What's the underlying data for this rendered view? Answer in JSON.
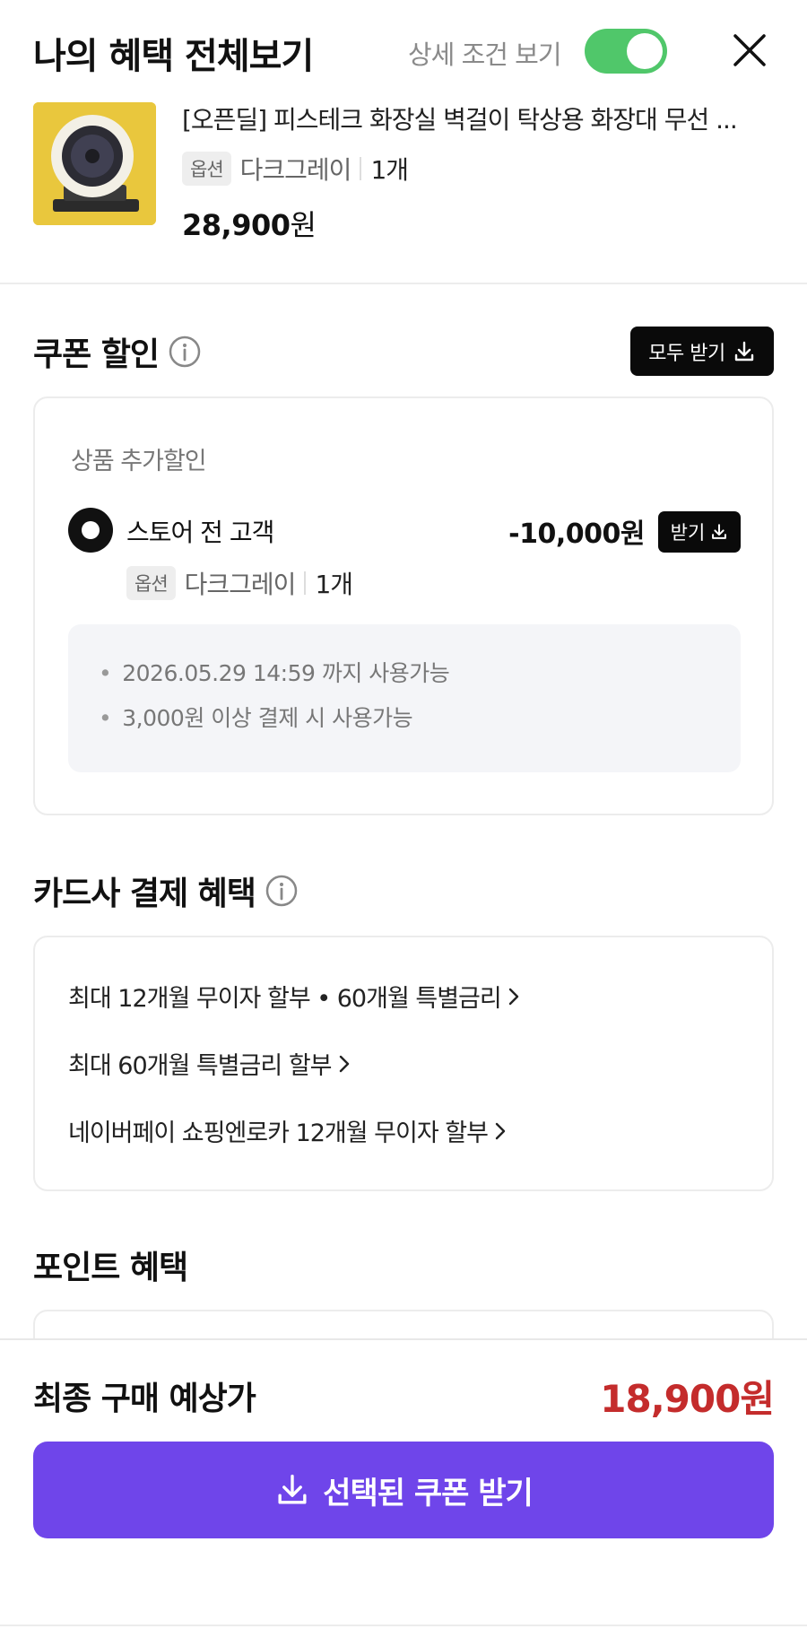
{
  "header": {
    "title": "나의 혜택 전체보기",
    "detail_toggle_label": "상세 조건 보기"
  },
  "product": {
    "title": "[오픈딜] 피스테크 화장실 벽걸이 탁상용 화장대 무선 ...",
    "option_badge": "옵션",
    "option_value": "다크그레이",
    "quantity": "1개",
    "price": "28,900",
    "price_unit": "원"
  },
  "coupon_section": {
    "title": "쿠폰 할인",
    "get_all_label": "모두 받기",
    "category": "상품 추가할인",
    "coupon": {
      "name": "스토어 전 고객",
      "amount": "-10,000",
      "amount_unit": "원",
      "get_label": "받기",
      "option_badge": "옵션",
      "option_value": "다크그레이",
      "quantity": "1개",
      "conditions": [
        "2026.05.29 14:59 까지 사용가능",
        "3,000원 이상 결제 시 사용가능"
      ]
    }
  },
  "card_section": {
    "title": "카드사 결제 혜택",
    "items": [
      "최대 12개월 무이자 할부 • 60개월 특별금리",
      "최대 60개월 특별금리 할부",
      "네이버페이 쇼핑엔로카 12개월 무이자 할부"
    ]
  },
  "points_section": {
    "title": "포인트 혜택"
  },
  "footer": {
    "final_label": "최종 구매 예상가",
    "final_price": "18,900",
    "final_price_unit": "원",
    "cta_label": "선택된 쿠폰 받기"
  },
  "colors": {
    "toggle_on": "#50c76a",
    "cta": "#6f45ea",
    "final_price": "#c42c2c"
  },
  "icons": {
    "close": "close-icon",
    "info": "info-icon",
    "download": "download-icon",
    "chevron": "chevron-right-icon"
  }
}
